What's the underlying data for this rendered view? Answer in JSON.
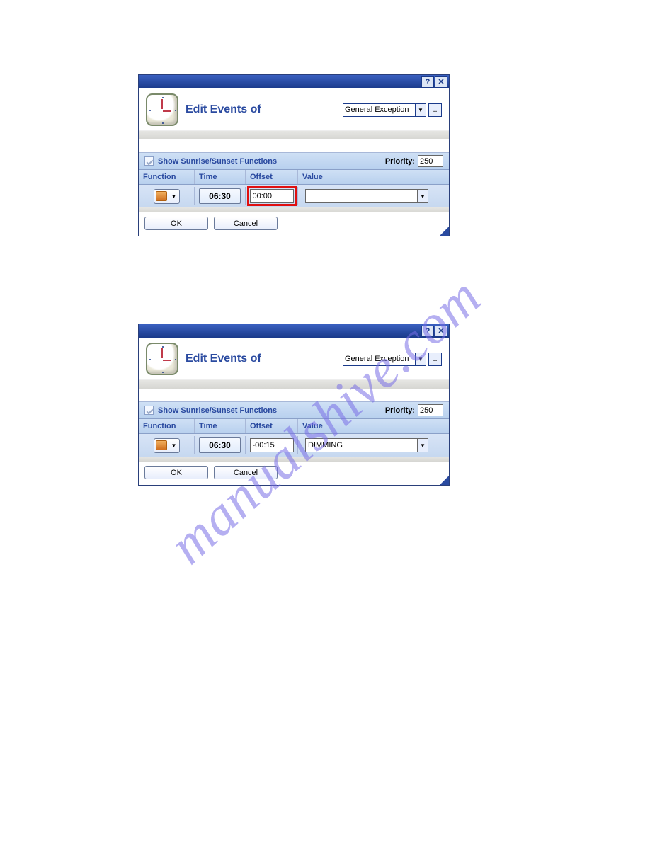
{
  "watermark": "manualshive.com",
  "dialogs": [
    {
      "title": "Edit Events of",
      "exception_selected": "General Exception",
      "show_sr_label": "Show Sunrise/Sunset Functions",
      "show_sr_checked": true,
      "priority_label": "Priority:",
      "priority_value": "250",
      "columns": {
        "func": "Function",
        "time": "Time",
        "offset": "Offset",
        "value": "Value"
      },
      "row": {
        "time": "06:30",
        "offset": "00:00",
        "value": "",
        "offset_highlight": true
      },
      "ok": "OK",
      "cancel": "Cancel"
    },
    {
      "title": "Edit Events of",
      "exception_selected": "General Exception",
      "show_sr_label": "Show Sunrise/Sunset Functions",
      "show_sr_checked": true,
      "priority_label": "Priority:",
      "priority_value": "250",
      "columns": {
        "func": "Function",
        "time": "Time",
        "offset": "Offset",
        "value": "Value"
      },
      "row": {
        "time": "06:30",
        "offset": "-00:15",
        "value": "DIMMING",
        "offset_highlight": false
      },
      "ok": "OK",
      "cancel": "Cancel"
    }
  ]
}
